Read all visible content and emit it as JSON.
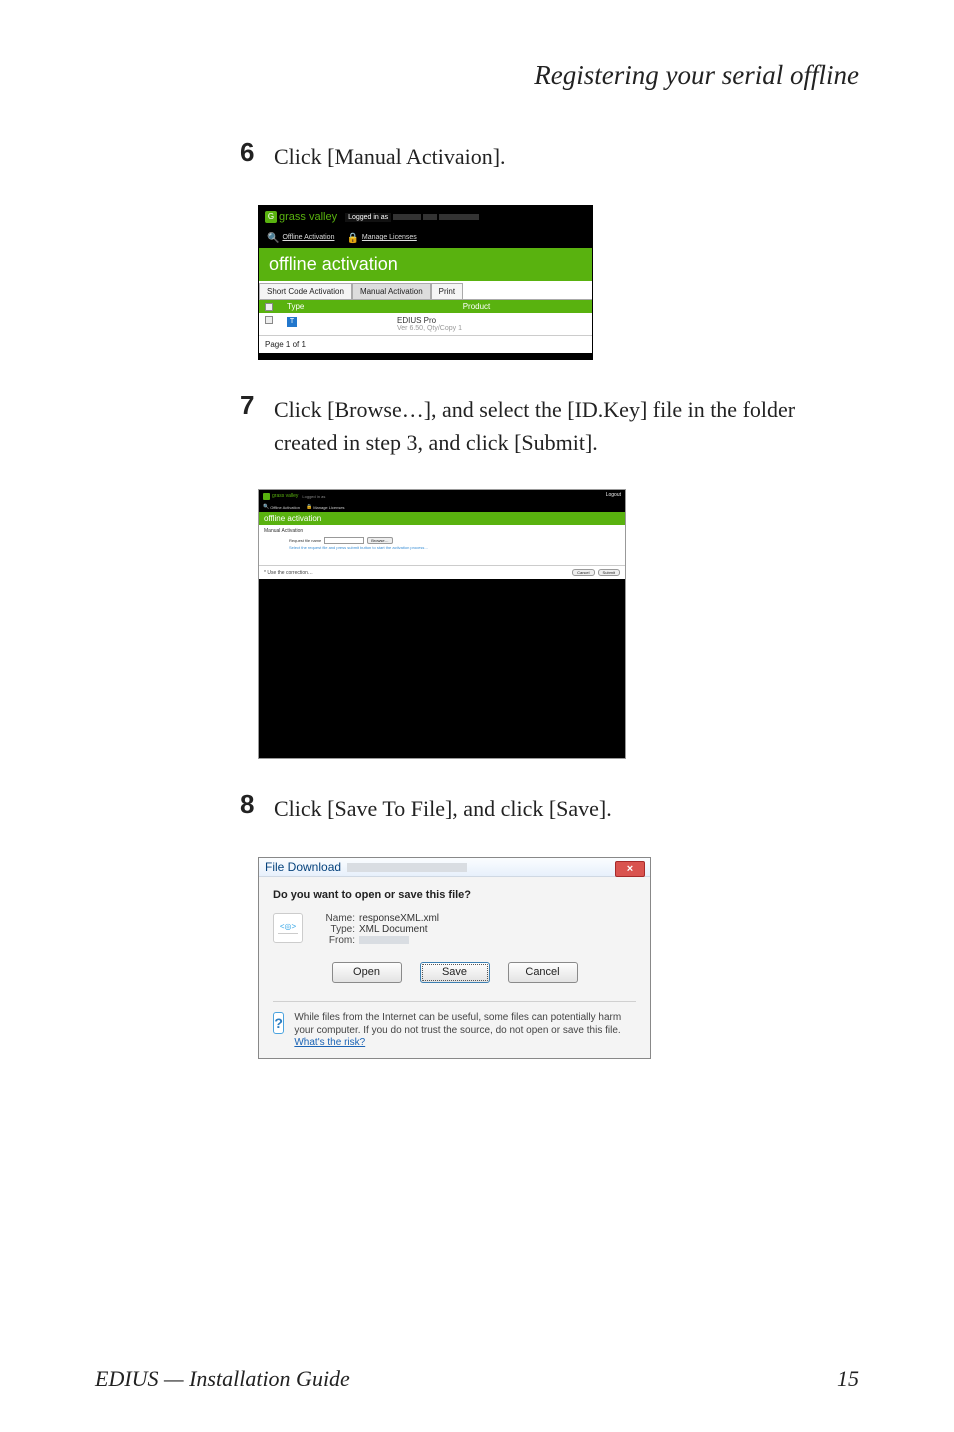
{
  "header": {
    "section_title": "Registering your serial offline"
  },
  "steps": {
    "s6": {
      "num": "6",
      "text": "Click [Manual Activaion]."
    },
    "s7": {
      "num": "7",
      "text": "Click [Browse…], and select the [ID.Key] file in the folder created in step 3, and click [Submit]."
    },
    "s8": {
      "num": "8",
      "text": "Click [Save To File], and click [Save]."
    }
  },
  "fig1": {
    "brand": "grass valley",
    "logged_in_as": "Logged in as",
    "nav_offline": "Offline\nActivation",
    "nav_manage": "Manage\nLicenses",
    "banner": "offline activation",
    "tab_short": "Short Code Activation",
    "tab_manual": "Manual Activation",
    "tab_print": "Print",
    "col_type": "Type",
    "col_product": "Product",
    "row_product": "EDIUS Pro",
    "row_product_sub": "Ver 6.50, Qty/Copy 1",
    "page_of": "Page 1 of 1"
  },
  "fig2": {
    "brand": "grass valley",
    "logged_in_as": "Logged in as",
    "logout": "Logout",
    "nav_offline": "Offline\nActivation",
    "nav_manage": "Manage\nLicenses",
    "banner": "offline activation",
    "subtitle": "Manual Activation",
    "field_label": "Request file name",
    "browse_btn": "Browse…",
    "hint_text": "Select the request file and press submit button to start the activation process…",
    "footer_text": "* Use the correction…",
    "cancel": "Cancel",
    "submit": "Submit"
  },
  "fig3": {
    "title": "File Download",
    "close": "×",
    "question": "Do you want to open or save this file?",
    "name_label": "Name:",
    "name_value": "responseXML.xml",
    "type_label": "Type:",
    "type_value": "XML Document",
    "from_label": "From:",
    "btn_open": "Open",
    "btn_save": "Save",
    "btn_cancel": "Cancel",
    "warn_text_a": "While files from the Internet can be useful, some files can potentially harm your computer. If you do not trust the source, do not open or save this file. ",
    "warn_link": "What's the risk?"
  },
  "footer": {
    "left": "EDIUS  —  Installation Guide",
    "right": "15"
  }
}
